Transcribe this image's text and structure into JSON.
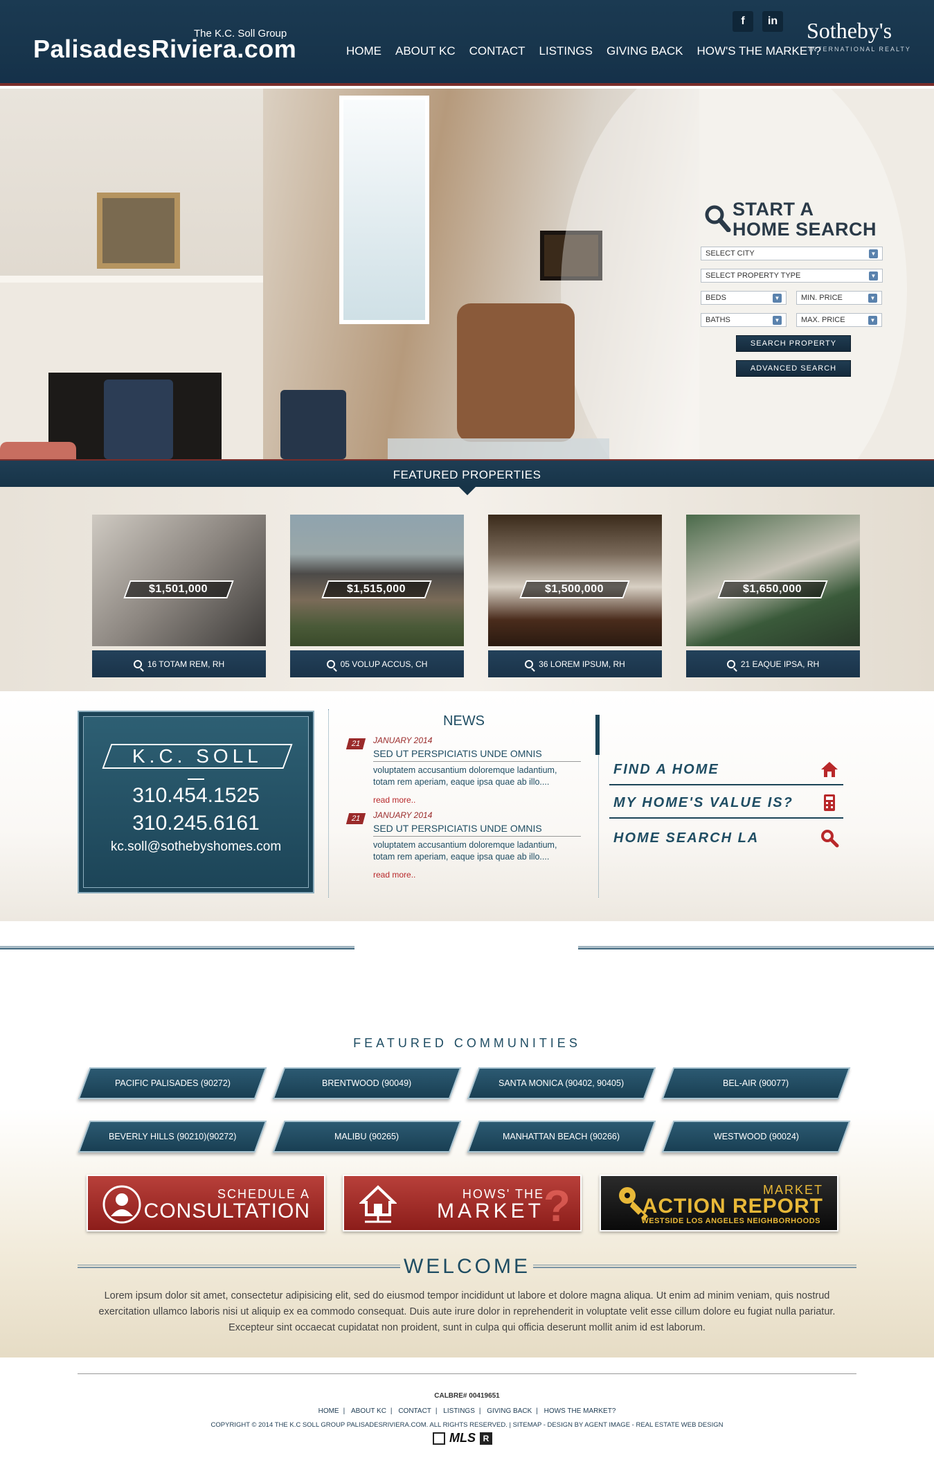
{
  "header": {
    "brand_sub": "The K.C. Soll Group",
    "brand_title": "PalisadesRiviera.com",
    "nav": [
      "HOME",
      "ABOUT KC",
      "CONTACT",
      "LISTINGS",
      "GIVING BACK",
      "HOW'S THE MARKET?"
    ],
    "social": {
      "facebook": "f",
      "linkedin": "in"
    },
    "sothebys": "Sotheby's",
    "sothebys_sub": "INTERNATIONAL REALTY"
  },
  "search": {
    "title_line1": "START A",
    "title_line2": "HOME SEARCH",
    "select_city": "SELECT CITY",
    "select_type": "SELECT PROPERTY TYPE",
    "beds": "BEDS",
    "min_price": "MIN. PRICE",
    "baths": "BATHS",
    "max_price": "MAX. PRICE",
    "search_btn": "SEARCH PROPERTY",
    "advanced_btn": "ADVANCED SEARCH"
  },
  "featured": {
    "title": "FEATURED PROPERTIES",
    "properties": [
      {
        "price": "$1,501,000",
        "address": "16 TOTAM REM, RH"
      },
      {
        "price": "$1,515,000",
        "address": "05 VOLUP ACCUS, CH"
      },
      {
        "price": "$1,500,000",
        "address": "36 LOREM IPSUM, RH"
      },
      {
        "price": "$1,650,000",
        "address": "21 EAQUE IPSA, RH"
      }
    ]
  },
  "contact": {
    "name": "K.C. SOLL",
    "phone1": "310.454.1525",
    "phone2": "310.245.6161",
    "email": "kc.soll@sothebyshomes.com"
  },
  "news": {
    "title": "NEWS",
    "items": [
      {
        "day": "21",
        "date": "JANUARY 2014",
        "headline": "SED UT PERSPICIATIS UNDE OMNIS",
        "body": "voluptatem accusantium doloremque ladantium, totam rem aperiam, eaque ipsa quae ab illo....",
        "more": "read more.."
      },
      {
        "day": "21",
        "date": "JANUARY 2014",
        "headline": "SED UT PERSPICIATIS UNDE OMNIS",
        "body": "voluptatem accusantium doloremque ladantium, totam rem aperiam, eaque ipsa quae ab illo....",
        "more": "read more.."
      }
    ]
  },
  "quick_links": [
    {
      "label": "FIND A HOME",
      "icon": "house-icon"
    },
    {
      "label": "MY HOME'S VALUE IS?",
      "icon": "calculator-icon"
    },
    {
      "label": "HOME SEARCH LA",
      "icon": "search-icon"
    }
  ],
  "communities": {
    "title": "FEATURED COMMUNITIES",
    "items": [
      "PACIFIC PALISADES (90272)",
      "BRENTWOOD (90049)",
      "SANTA MONICA (90402, 90405)",
      "BEL-AIR (90077)",
      "BEVERLY HILLS (90210)(90272)",
      "MALIBU (90265)",
      "MANHATTAN BEACH (90266)",
      "WESTWOOD (90024)"
    ]
  },
  "cta": {
    "consult_small": "SCHEDULE A",
    "consult_big": "CONSULTATION",
    "market_small": "HOWS' THE",
    "market_big": "MARKET",
    "report_small": "MARKET",
    "report_big": "ACTION REPORT",
    "report_tiny": "WESTSIDE LOS ANGELES NEIGHBORHOODS"
  },
  "welcome": {
    "title": "WELCOME",
    "text": "Lorem ipsum dolor sit amet, consectetur adipisicing elit, sed do eiusmod tempor incididunt ut labore et dolore magna aliqua. Ut enim ad minim veniam, quis nostrud exercitation ullamco laboris nisi ut aliquip ex ea commodo consequat. Duis aute irure dolor in reprehenderit in voluptate velit esse cillum dolore eu fugiat nulla pariatur. Excepteur sint occaecat cupidatat non proident, sunt in culpa qui officia deserunt mollit anim id est laborum."
  },
  "footer": {
    "calbre": "CALBRE# 00419651",
    "nav": [
      "HOME",
      "ABOUT KC",
      "CONTACT",
      "LISTINGS",
      "GIVING BACK",
      "HOWS THE MARKET?"
    ],
    "copyright": "COPYRIGHT © 2014 THE K.C SOLL GROUP PALISADESRIVIERA.COM. ALL RIGHTS RESERVED. | SITEMAP - DESIGN BY AGENT IMAGE - REAL ESTATE WEB DESIGN",
    "mls": "MLS",
    "realtor": "R"
  }
}
